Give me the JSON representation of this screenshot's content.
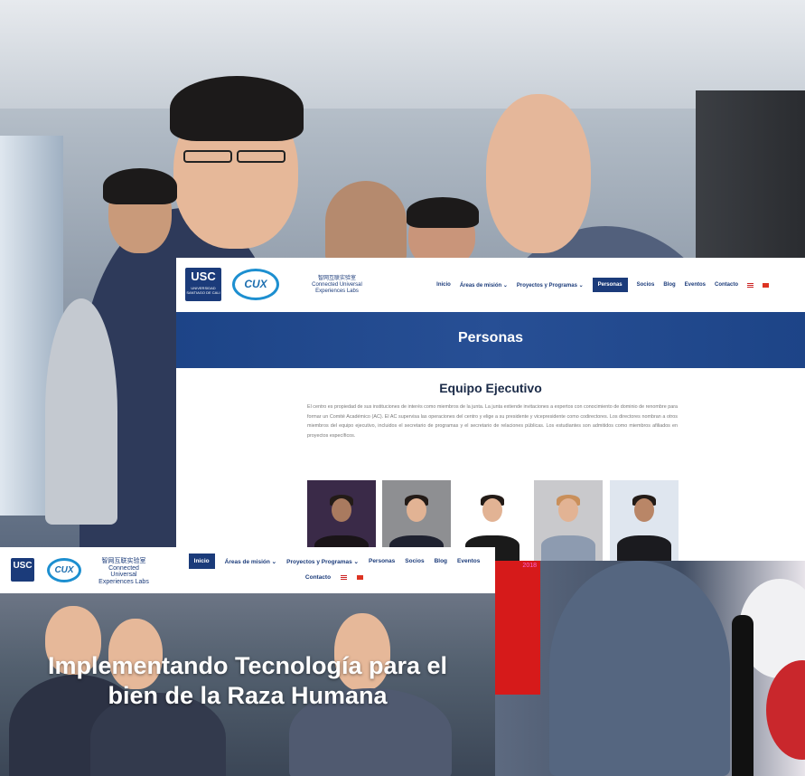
{
  "shot1": {
    "logo_usc": "USC",
    "logo_usc_sub": "UNIVERSIDAD SANTIAGO DE CALI",
    "logo_cux": "CUX",
    "lab_chinese": "智网互联实验室",
    "lab_name_1": "Connected Universal",
    "lab_name_2": "Experiences Labs",
    "menu": [
      "Inicio",
      "Áreas de misión ⌄",
      "Proyectos y Programas ⌄",
      "Personas",
      "Socios",
      "Blog",
      "Eventos",
      "Contacto"
    ],
    "banner_title": "Personas",
    "section_title": "Equipo Ejecutivo",
    "paragraph": "El centro es propiedad de sus instituciones de interés como miembros de la junta. La junta extiende invitaciones a expertos con conocimiento de dominio de renombre para formar un Comité Académico (AC). El AC supervisa las operaciones del centro y elige a su presidente y vicepresidente como codirectores. Los directores nombran a otros miembros del equipo ejecutivo, incluidos el secretario de programas y el secretario de relaciones públicas. Los estudiantes son admitidos como miembros afiliados en proyectos específicos."
  },
  "shot2": {
    "logo_usc": "USC",
    "logo_cux": "CUX",
    "lab_chinese": "智网互联实验室",
    "lab_name_1": "Connected",
    "lab_name_2": "Universal",
    "lab_name_3": "Experiences Labs",
    "menu": [
      "Inicio",
      "Áreas de misión ⌄",
      "Proyectos y Programas ⌄",
      "Personas",
      "Socios",
      "Blog",
      "Eventos",
      "Contacto"
    ],
    "hero_title_1": "Implementando Tecnología para el",
    "hero_title_2": "bien de la Raza Humana"
  },
  "red_card_text": "2018",
  "colors": {
    "brand_blue": "#1b3b7a",
    "accent_blue": "#1d8fd0",
    "banner_blue": "#1d4487"
  }
}
